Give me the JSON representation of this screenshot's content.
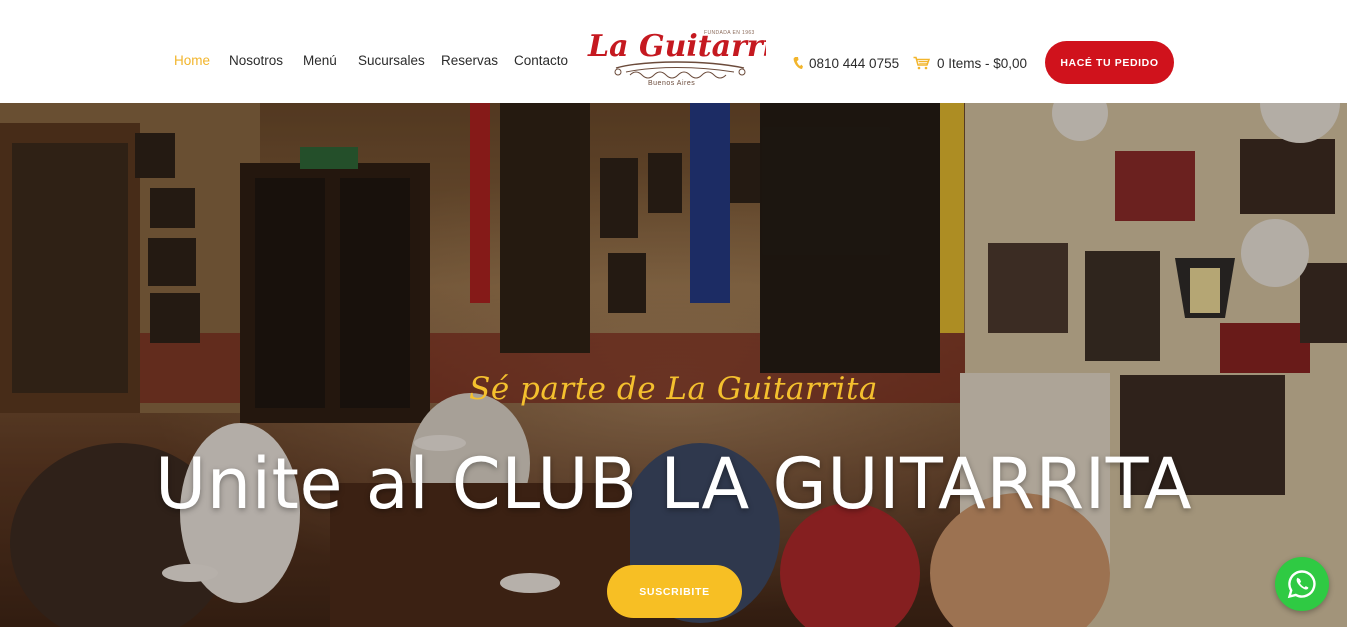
{
  "nav": {
    "items": [
      {
        "label": "Home",
        "active": true
      },
      {
        "label": "Nosotros",
        "active": false
      },
      {
        "label": "Menú",
        "active": false
      },
      {
        "label": "Sucursales",
        "active": false
      },
      {
        "label": "Reservas",
        "active": false
      },
      {
        "label": "Contacto",
        "active": false
      }
    ]
  },
  "logo": {
    "name": "La Guitarrita",
    "founded": "FUNDADA EN 1963",
    "tagline": "Buenos Aires"
  },
  "header": {
    "phone": "0810 444 0755",
    "phone_icon": "phone-icon",
    "cart": "0 Items - $0,00",
    "cart_icon": "cart-icon",
    "order_button": "HACÉ TU PEDIDO"
  },
  "hero": {
    "subtitle": "Sé parte de La Guitarrita",
    "title": "Unite al CLUB LA GUITARRITA",
    "button": "SUSCRIBITE"
  },
  "floating": {
    "whatsapp_icon": "whatsapp-icon"
  },
  "colors": {
    "accent": "#f2b52c",
    "brand_red": "#d0121c",
    "subscribe": "#f7bf24",
    "whatsapp": "#2fca43"
  }
}
